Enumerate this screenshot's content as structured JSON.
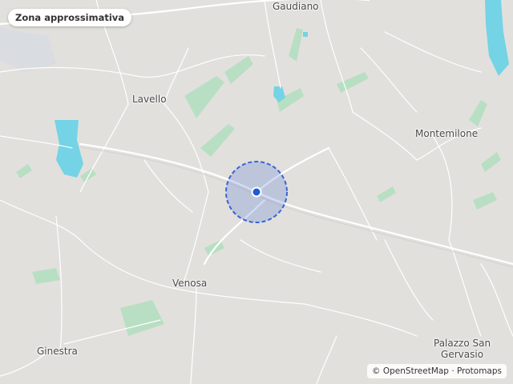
{
  "badge": {
    "label": "Zona approssimativa"
  },
  "places": {
    "gaudiano": "Gaudiano",
    "lavello": "Lavello",
    "montemilone": "Montemilone",
    "venosa": "Venosa",
    "ginestra": "Ginestra",
    "palazzo_line1": "Palazzo San",
    "palazzo_line2": "Gervasio"
  },
  "attribution": {
    "osm": "© OpenStreetMap",
    "separator": " · ",
    "protomaps": "Protomaps"
  },
  "colors": {
    "land": "#e2e0dd",
    "water": "#74d3e4",
    "park": "#b8dfc3",
    "road": "#ffffff",
    "accuracy_fill": "#3d63d8",
    "accuracy_stroke": "#3a63d6",
    "marker": "#1f5ad6"
  },
  "icons": {
    "marker": "location-dot-icon"
  }
}
